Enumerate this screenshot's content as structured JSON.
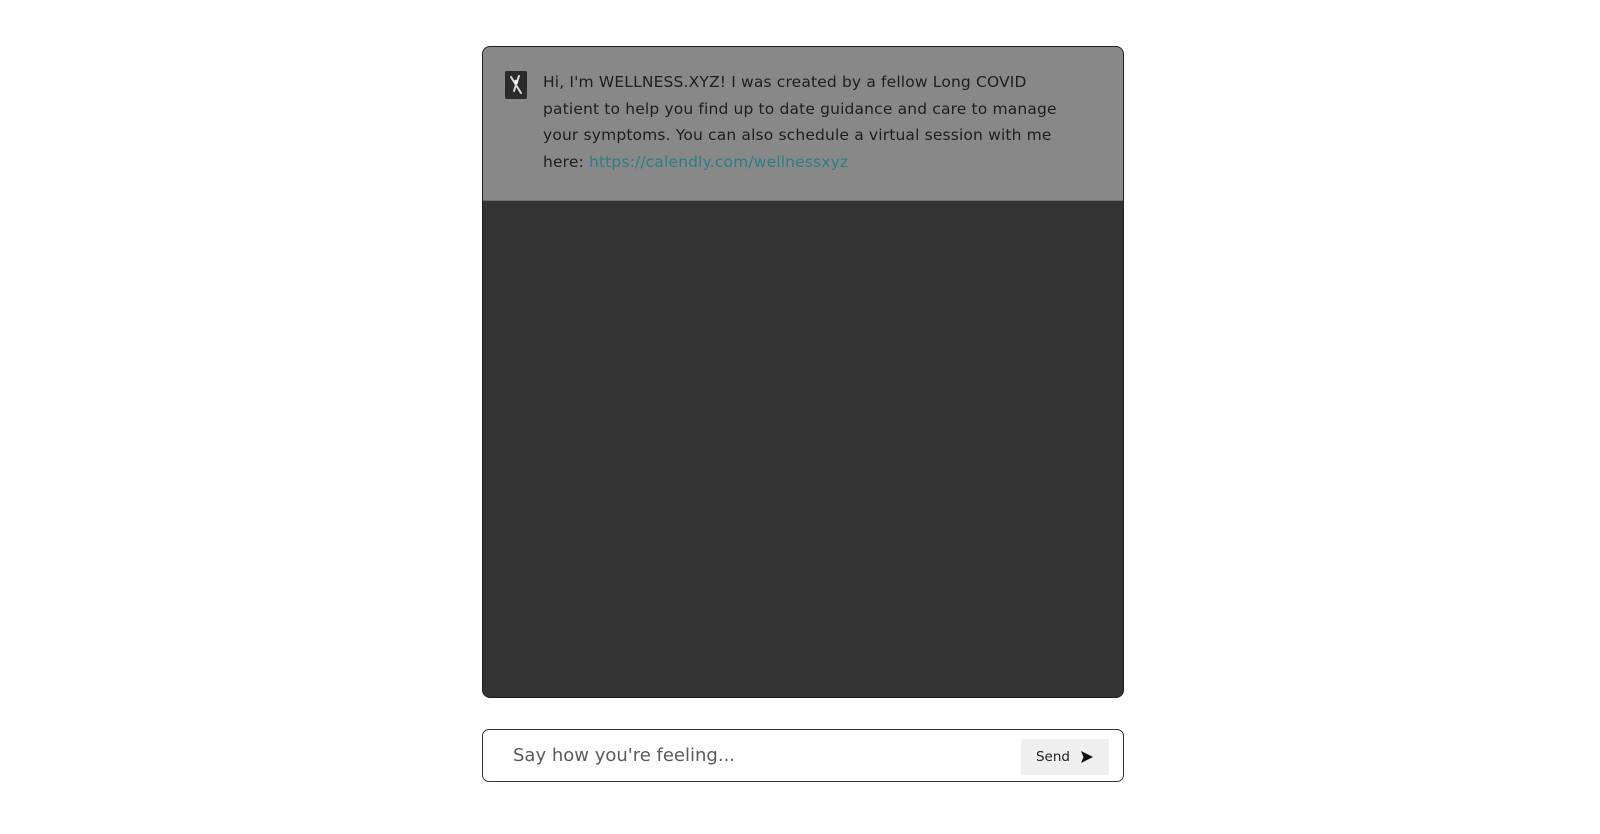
{
  "chat": {
    "welcome_message": {
      "text": "Hi, I'm WELLNESS.XYZ! I was created by a fellow Long COVID patient to help you find up to date guidance and care to manage your symptoms. You can also schedule a virtual session with me here:",
      "link": "https://calendly.com/wellnessxyz",
      "avatar_icon": "bot-avatar-icon"
    }
  },
  "composer": {
    "placeholder": "Say how you're feeling...",
    "value": "",
    "send_label": "Send",
    "send_icon": "send-arrow-icon"
  },
  "colors": {
    "chat_background": "#333333",
    "message_background": "#888888",
    "link": "#2a7f86",
    "send_button_background": "#efefef"
  }
}
